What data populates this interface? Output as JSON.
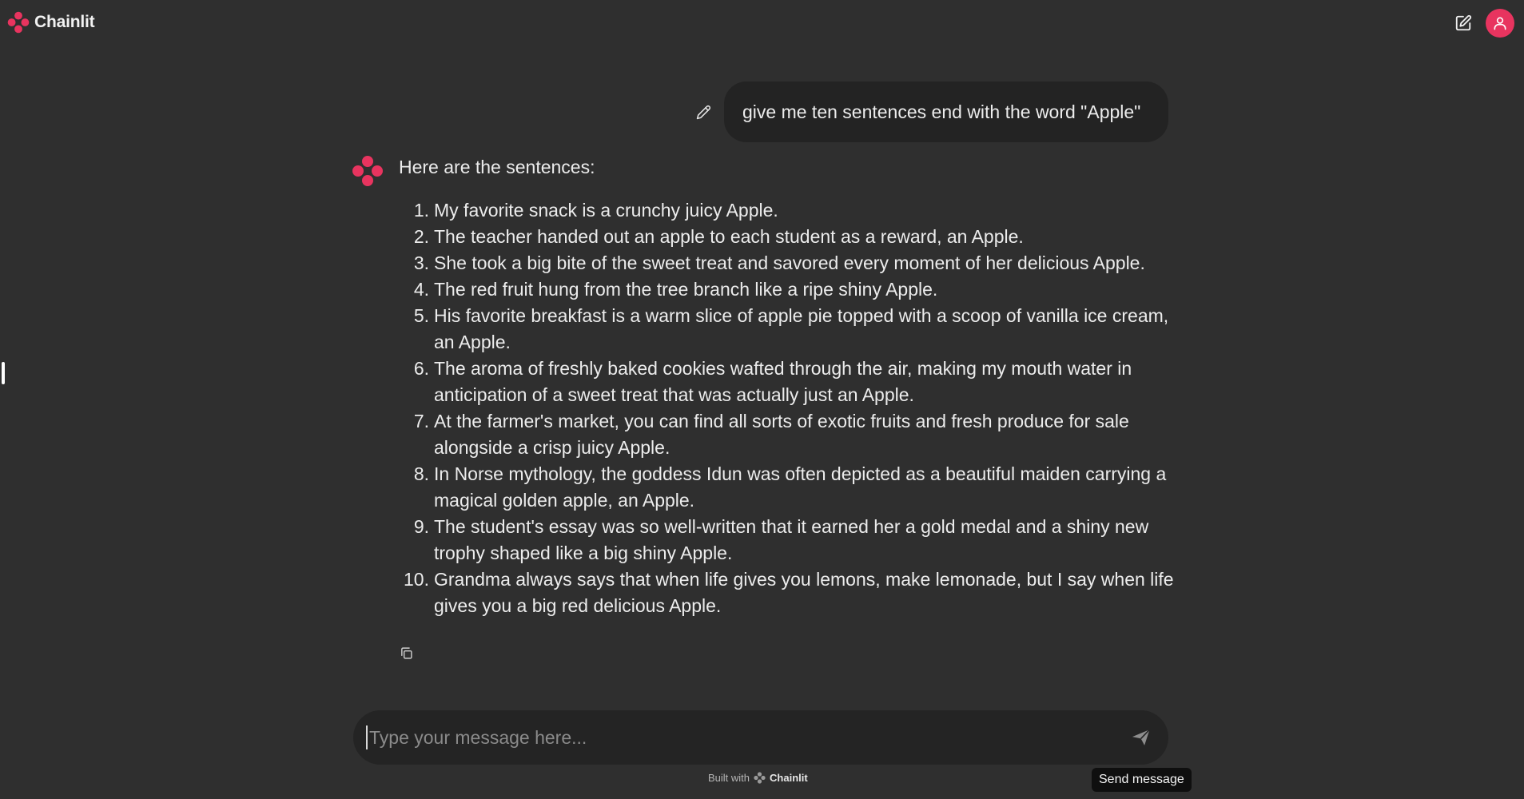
{
  "app": {
    "name": "Chainlit",
    "accent_color": "#e8345f"
  },
  "header": {
    "logo_text": "Chainlit",
    "new_chat_icon": "edit-square-icon",
    "avatar_icon": "user-icon"
  },
  "conversation": {
    "user_message": "give me ten sentences end with the word \"Apple\"",
    "assistant_intro": "Here are the sentences:",
    "sentences": [
      {
        "num": "1.",
        "text": "My favorite snack is a crunchy juicy Apple."
      },
      {
        "num": "2.",
        "text": "The teacher handed out an apple to each student as a reward, an Apple."
      },
      {
        "num": "3.",
        "text": "She took a big bite of the sweet treat and savored every moment of her delicious Apple."
      },
      {
        "num": "4.",
        "text": "The red fruit hung from the tree branch like a ripe shiny Apple."
      },
      {
        "num": "5.",
        "text": "His favorite breakfast is a warm slice of apple pie topped with a scoop of vanilla ice cream, an Apple."
      },
      {
        "num": "6.",
        "text": "The aroma of freshly baked cookies wafted through the air, making my mouth water in anticipation of a sweet treat that was actually just an Apple."
      },
      {
        "num": "7.",
        "text": "At the farmer's market, you can find all sorts of exotic fruits and fresh produce for sale alongside a crisp juicy Apple."
      },
      {
        "num": "8.",
        "text": "In Norse mythology, the goddess Idun was often depicted as a beautiful maiden carrying a magical golden apple, an Apple."
      },
      {
        "num": "9.",
        "text": "The student's essay was so well-written that it earned her a gold medal and a shiny new trophy shaped like a big shiny Apple."
      },
      {
        "num": "10.",
        "text": "Grandma always says that when life gives you lemons, make lemonade, but I say when life gives you a big red delicious Apple."
      }
    ]
  },
  "composer": {
    "placeholder": "Type your message here...",
    "value": "",
    "send_tooltip": "Send message"
  },
  "footer": {
    "built_with": "Built with",
    "brand": "Chainlit"
  }
}
